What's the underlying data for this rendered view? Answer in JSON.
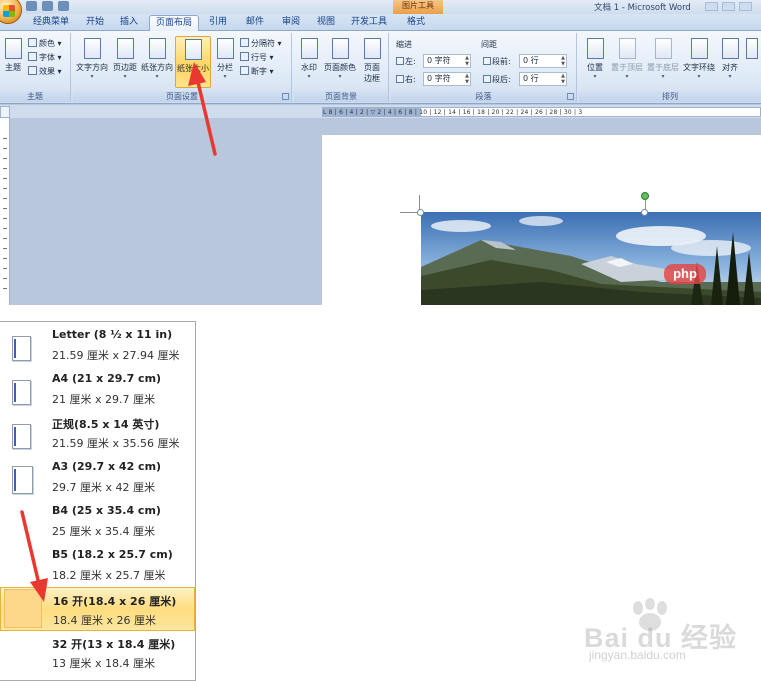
{
  "window": {
    "contextual_header": "图片工具",
    "title": "文档 1 - Microsoft Word"
  },
  "tabs": [
    {
      "label": "经典菜单",
      "active": false
    },
    {
      "label": "开始",
      "active": false
    },
    {
      "label": "插入",
      "active": false
    },
    {
      "label": "页面布局",
      "active": true
    },
    {
      "label": "引用",
      "active": false
    },
    {
      "label": "邮件",
      "active": false
    },
    {
      "label": "审阅",
      "active": false
    },
    {
      "label": "视图",
      "active": false
    },
    {
      "label": "开发工具",
      "active": false
    },
    {
      "label": "格式",
      "active": false
    }
  ],
  "ribbon": {
    "theme_group": {
      "label": "主题",
      "theme_btn": "主题",
      "colors": "颜色",
      "fonts": "字体",
      "effects": "效果"
    },
    "page_setup_group": {
      "label": "页面设置",
      "text_direction": "文字方向",
      "margins": "页边距",
      "orientation": "纸张方向",
      "paper_size": "纸张大小",
      "columns": "分栏",
      "breaks": "分隔符",
      "line_numbers": "行号",
      "hyphenation": "断字"
    },
    "page_background_group": {
      "label": "页面背景",
      "watermark": "水印",
      "page_color": "页面颜色",
      "page_borders_line1": "页面",
      "page_borders_line2": "边框"
    },
    "paragraph_group": {
      "label": "段落",
      "indent_label": "缩进",
      "spacing_label": "间距",
      "left_label": "左:",
      "right_label": "右:",
      "left_value": "0 字符",
      "right_value": "0 字符",
      "before_label": "段前:",
      "after_label": "段后:",
      "before_value": "0 行",
      "after_value": "0 行"
    },
    "arrange_group": {
      "label": "排列",
      "position": "位置",
      "bring_front": "置于顶层",
      "send_back": "置于底层",
      "text_wrap": "文字环绕",
      "align": "对齐"
    }
  },
  "ruler": {
    "text": "L  8 | 6 | 4 | 2 |  ▽ 2 | 4 | 6 | 8 | 10 | 12 | 14 | 16 | 18 | 20 | 22 | 24 | 26 | 28 | 30 | 3"
  },
  "image_overlay": {
    "badge": "php"
  },
  "paper_menu": {
    "items": [
      {
        "title": "Letter (8 ½ x 11 in)",
        "sub": "21.59 厘米 x 27.94 厘米",
        "selected": false
      },
      {
        "title": "A4 (21 x 29.7 cm)",
        "sub": "21 厘米 x 29.7 厘米",
        "selected": false
      },
      {
        "title": "正规(8.5 x 14 英寸)",
        "sub": "21.59 厘米 x 35.56 厘米",
        "selected": false
      },
      {
        "title": "A3 (29.7 x 42 cm)",
        "sub": "29.7 厘米 x 42 厘米",
        "selected": false
      },
      {
        "title": "B4 (25 x 35.4 cm)",
        "sub": "25 厘米 x 35.4 厘米",
        "selected": false
      },
      {
        "title": "B5 (18.2 x 25.7 cm)",
        "sub": "18.2 厘米 x 25.7 厘米",
        "selected": false
      },
      {
        "title": "16 开(18.4 x 26 厘米)",
        "sub": "18.4 厘米 x 26 厘米",
        "selected": true
      },
      {
        "title": "32 开(13 x 18.4 厘米)",
        "sub": "13 厘米 x 18.4 厘米",
        "selected": false
      }
    ]
  },
  "watermark": {
    "brand": "Bai du 经验",
    "url": "jingyan.baidu.com"
  },
  "colors": {
    "annotation_arrow": "#e8382f",
    "selected_highlight": "#ffdd7e",
    "ribbon_hot": "#ffd35e"
  }
}
